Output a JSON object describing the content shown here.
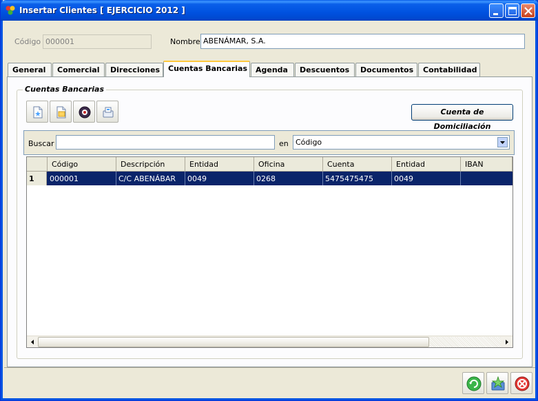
{
  "window": {
    "title": "Insertar Clientes [ EJERCICIO 2012 ]",
    "accent": "#0a246a"
  },
  "header": {
    "codigo_label": "Código",
    "codigo_value": "000001",
    "nombre_label": "Nombre",
    "nombre_value": "ABENÁMAR, S.A."
  },
  "tabs": [
    {
      "label": "General"
    },
    {
      "label": "Comercial"
    },
    {
      "label": "Direcciones"
    },
    {
      "label": "Cuentas Bancarias",
      "active": true
    },
    {
      "label": "Agenda"
    },
    {
      "label": "Descuentos"
    },
    {
      "label": "Documentos"
    },
    {
      "label": "Contabilidad"
    }
  ],
  "group": {
    "title": "Cuentas Bancarias",
    "toolbar_icons": [
      "new-record-icon",
      "edit-record-icon",
      "delete-record-icon",
      "print-icon"
    ],
    "domiciliacion_button": "Cuenta de Domiciliación"
  },
  "search": {
    "buscar_label": "Buscar",
    "buscar_value": "",
    "en_label": "en",
    "en_selected": "Código"
  },
  "grid": {
    "columns": [
      "Código",
      "Descripción",
      "Entidad",
      "Oficina",
      "Cuenta",
      "Entidad",
      "IBAN"
    ],
    "rows": [
      {
        "num": "1",
        "cells": [
          "000001",
          "C/C ABENÁBAR",
          "0049",
          "0268",
          "5475475475",
          "0049",
          ""
        ]
      }
    ]
  },
  "footer": {
    "buttons": [
      "refresh-icon",
      "save-star-icon",
      "cancel-icon"
    ]
  }
}
